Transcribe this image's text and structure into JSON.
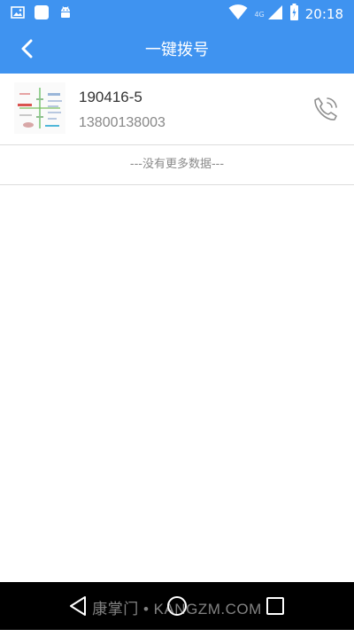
{
  "status_bar": {
    "time": "20:18",
    "network": "4G",
    "icons": [
      "gallery-icon",
      "app-icon",
      "android-icon",
      "wifi-icon",
      "signal-icon",
      "battery-icon"
    ]
  },
  "app_bar": {
    "title": "一键拨号",
    "back_icon": "chevron-left-icon",
    "color": "#3f93f0"
  },
  "contacts": [
    {
      "name": "190416-5",
      "phone": "13800138003",
      "call_icon": "phone-call-icon"
    }
  ],
  "list_footer": "---没有更多数据---",
  "nav_bar": {
    "buttons": [
      "back-triangle-icon",
      "home-circle-icon",
      "recents-square-icon"
    ],
    "watermark": "康掌门 • KANGZM.COM"
  }
}
